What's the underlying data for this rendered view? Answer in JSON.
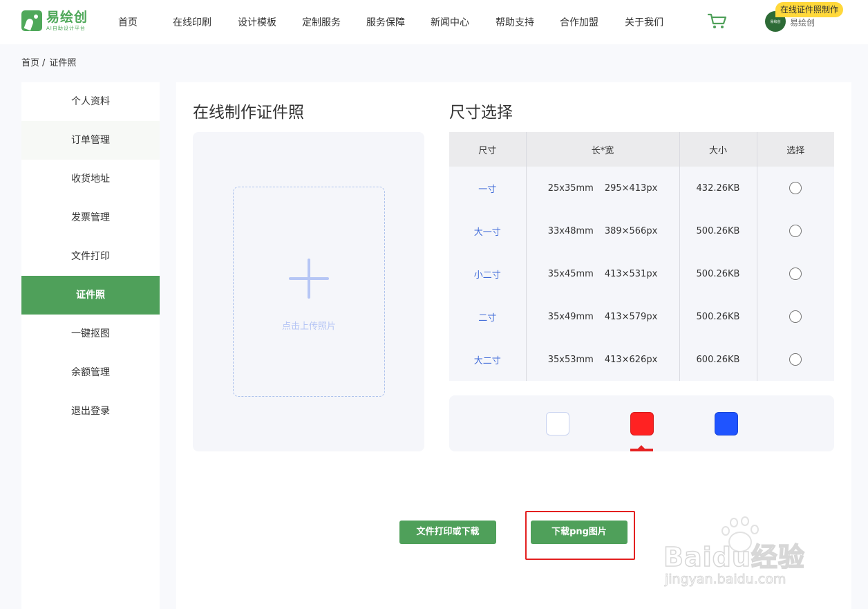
{
  "header": {
    "logo": {
      "name": "易绘创",
      "subtitle": "AI自助设计平台"
    },
    "nav": [
      "首页",
      "在线印刷",
      "设计模板",
      "定制服务",
      "服务保障",
      "新闻中心",
      "帮助支持",
      "合作加盟",
      "关于我们"
    ],
    "avatar_text": "易绘创",
    "user_name": "易绘创",
    "promo_badge": "在线证件照制作"
  },
  "breadcrumb": {
    "home": "首页",
    "separator": "/",
    "current": "证件照"
  },
  "sidebar": {
    "items": [
      "个人资料",
      "订单管理",
      "收货地址",
      "发票管理",
      "文件打印",
      "证件照",
      "一键抠图",
      "余额管理",
      "退出登录"
    ],
    "active": "证件照"
  },
  "upload": {
    "title": "在线制作证件照",
    "hint": "点击上传照片"
  },
  "size_selection": {
    "title": "尺寸选择",
    "columns": [
      "尺寸",
      "长*宽",
      "大小",
      "选择"
    ],
    "rows": [
      {
        "name": "一寸",
        "mm": "25x35mm",
        "px": "295×413px",
        "file_size": "432.26KB"
      },
      {
        "name": "大一寸",
        "mm": "33x48mm",
        "px": "389×566px",
        "file_size": "500.26KB"
      },
      {
        "name": "小二寸",
        "mm": "35x45mm",
        "px": "413×531px",
        "file_size": "500.26KB"
      },
      {
        "name": "二寸",
        "mm": "35x49mm",
        "px": "413×579px",
        "file_size": "500.26KB"
      },
      {
        "name": "大二寸",
        "mm": "35x53mm",
        "px": "413×626px",
        "file_size": "600.26KB"
      }
    ]
  },
  "background_colors": {
    "options": [
      {
        "name": "white",
        "hex": "#ffffff"
      },
      {
        "name": "red",
        "hex": "#ff2222"
      },
      {
        "name": "blue",
        "hex": "#1f54ff"
      }
    ],
    "selected": "red"
  },
  "buttons": {
    "print": "文件打印或下载",
    "download": "下载png图片"
  },
  "watermark": {
    "brand": "Baidu经验",
    "url": "jingyan.baidu.com"
  },
  "colors": {
    "brand_green": "#4fa05a",
    "link_blue": "#3f6ad8",
    "highlight_red": "#e32020",
    "badge_yellow": "#ffd83b"
  }
}
